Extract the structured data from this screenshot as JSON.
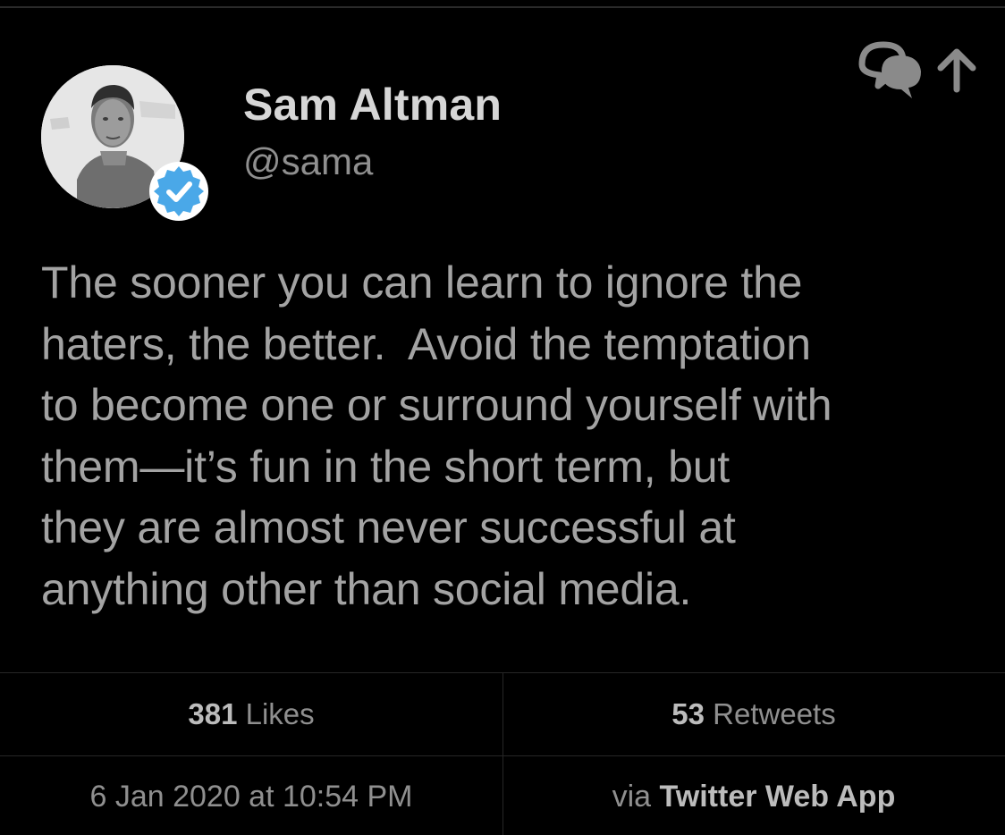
{
  "tweet": {
    "author": {
      "display_name": "Sam Altman",
      "handle": "@sama",
      "verified": true,
      "avatar": "profile-photo"
    },
    "text": "The sooner you can learn to ignore the haters, the better.  Avoid the temptation to become one or surround yourself with them—it’s fun in the short term, but they are almost never successful at anything other than social media.",
    "text_lines": [
      "The sooner you can learn to ignore the",
      "haters, the better.  Avoid the temptation",
      "to become one or surround yourself with",
      "them—it’s fun in the short term, but",
      "they are almost never successful at",
      "anything other than social media."
    ],
    "stats": {
      "likes_count": "381",
      "likes_label": "Likes",
      "retweets_count": "53",
      "retweets_label": "Retweets"
    },
    "timestamp": "6 Jan 2020 at 10:54 PM",
    "source_prefix": "via",
    "source_app": "Twitter Web App"
  },
  "icons": {
    "reply": "reply-bubbles-icon",
    "share": "share-arrow-icon",
    "verified": "verified-check-icon"
  },
  "colors": {
    "background": "#000000",
    "verified_blue": "#4aa8e8",
    "name_text": "#d6d6d6",
    "body_text": "#a3a3a3",
    "muted_text": "#8f8f8f",
    "divider": "#262626"
  }
}
